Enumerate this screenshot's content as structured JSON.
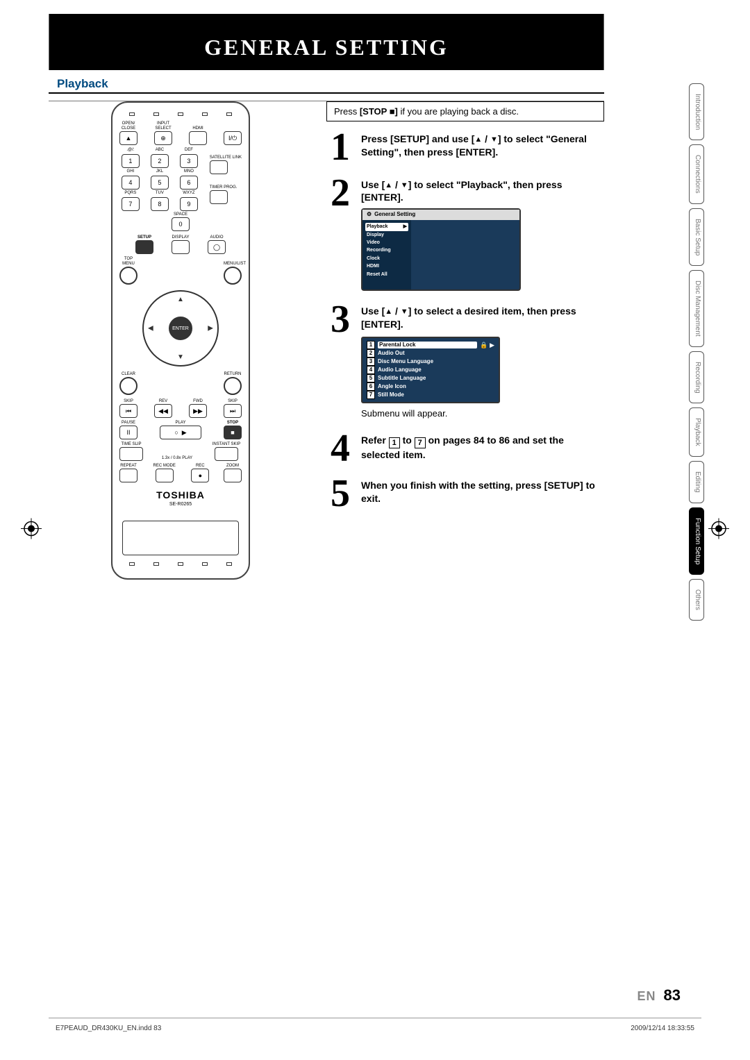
{
  "page": {
    "title": "GENERAL SETTING",
    "section": "Playback",
    "lang": "EN",
    "number": "83",
    "footer_file": "E7PEAUD_DR430KU_EN.indd   83",
    "footer_date": "2009/12/14   18:33:55"
  },
  "info_box": {
    "prefix": "Press ",
    "button": "[STOP ■]",
    "suffix": " if you are playing back a disc."
  },
  "steps": {
    "s1": {
      "num": "1",
      "text_a": "Press [SETUP] and use [",
      "text_b": " / ",
      "text_c": "] to select \"General Setting\", then press [ENTER]."
    },
    "s2": {
      "num": "2",
      "text_a": "Use [",
      "text_b": " / ",
      "text_c": "] to select \"Playback\", then press [ENTER]."
    },
    "s3": {
      "num": "3",
      "text_a": "Use [",
      "text_b": " / ",
      "text_c": "] to select a desired item, then press [ENTER].",
      "note": "Submenu will appear."
    },
    "s4": {
      "num": "4",
      "text_a": "Refer ",
      "text_b": " to ",
      "text_c": " on pages 84 to 86 and set the selected item.",
      "box_a": "1",
      "box_b": "7"
    },
    "s5": {
      "num": "5",
      "text": "When you finish with the setting, press [SETUP] to exit."
    }
  },
  "osd": {
    "title": "General Setting",
    "items": [
      "Playback",
      "Display",
      "Video",
      "Recording",
      "Clock",
      "HDMI",
      "Reset All"
    ]
  },
  "submenu": {
    "items": [
      {
        "n": "1",
        "t": "Parental Lock",
        "sel": true
      },
      {
        "n": "2",
        "t": "Audio Out"
      },
      {
        "n": "3",
        "t": "Disc Menu Language"
      },
      {
        "n": "4",
        "t": "Audio Language"
      },
      {
        "n": "5",
        "t": "Subtitle Language"
      },
      {
        "n": "6",
        "t": "Angle Icon"
      },
      {
        "n": "7",
        "t": "Still Mode"
      }
    ]
  },
  "side_tabs": [
    "Introduction",
    "Connections",
    "Basic Setup",
    "Disc\nManagement",
    "Recording",
    "Playback",
    "Editing",
    "Function Setup",
    "Others"
  ],
  "remote": {
    "brand": "TOSHIBA",
    "model": "SE-R0265",
    "row1": {
      "a": "OPEN/\nCLOSE",
      "b": "INPUT\nSELECT",
      "c": "HDMI",
      "d": ""
    },
    "power": "I/⏻",
    "numlabels": {
      "r1": [
        ".@/:",
        "ABC",
        "DEF"
      ],
      "r2": [
        "GHI",
        "JKL",
        "MNO"
      ],
      "r3": [
        "PQRS",
        "TUV",
        "WXYZ"
      ],
      "space": "SPACE"
    },
    "nums": {
      "r1": [
        "1",
        "2",
        "3"
      ],
      "r2": [
        "4",
        "5",
        "6"
      ],
      "r3": [
        "7",
        "8",
        "9"
      ],
      "zero": "0"
    },
    "satellite": "SATELLITE\nLINK",
    "timer": "TIMER\nPROG.",
    "rowA": {
      "a": "SETUP",
      "b": "DISPLAY",
      "c": "AUDIO"
    },
    "navL": "TOP MENU",
    "navR": "MENU/LIST",
    "enter": "ENTER",
    "clear": "CLEAR",
    "ret": "RETURN",
    "trans": {
      "a": "SKIP",
      "b": "REV",
      "c": "FWD",
      "d": "SKIP"
    },
    "trans2": {
      "a": "PAUSE",
      "b": "PLAY",
      "c": "STOP"
    },
    "trans3": {
      "a": "TIME SLIP",
      "b": "1.3x / 0.8x PLAY",
      "c": "INSTANT SKIP"
    },
    "trans4": {
      "a": "REPEAT",
      "b": "REC MODE",
      "c": "REC",
      "d": "ZOOM"
    }
  }
}
